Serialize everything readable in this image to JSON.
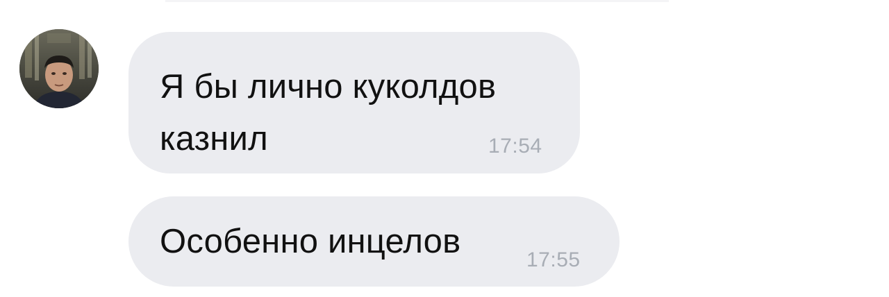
{
  "colors": {
    "bubble_bg": "#ebecf0",
    "text": "#111111",
    "time": "#a8adb5",
    "background": "#ffffff"
  },
  "icons": {
    "avatar": "user-photo-avatar"
  },
  "messages": [
    {
      "text": "Я бы лично куколдов\nказнил",
      "time": "17:54"
    },
    {
      "text": "Особенно инцелов",
      "time": "17:55"
    }
  ]
}
